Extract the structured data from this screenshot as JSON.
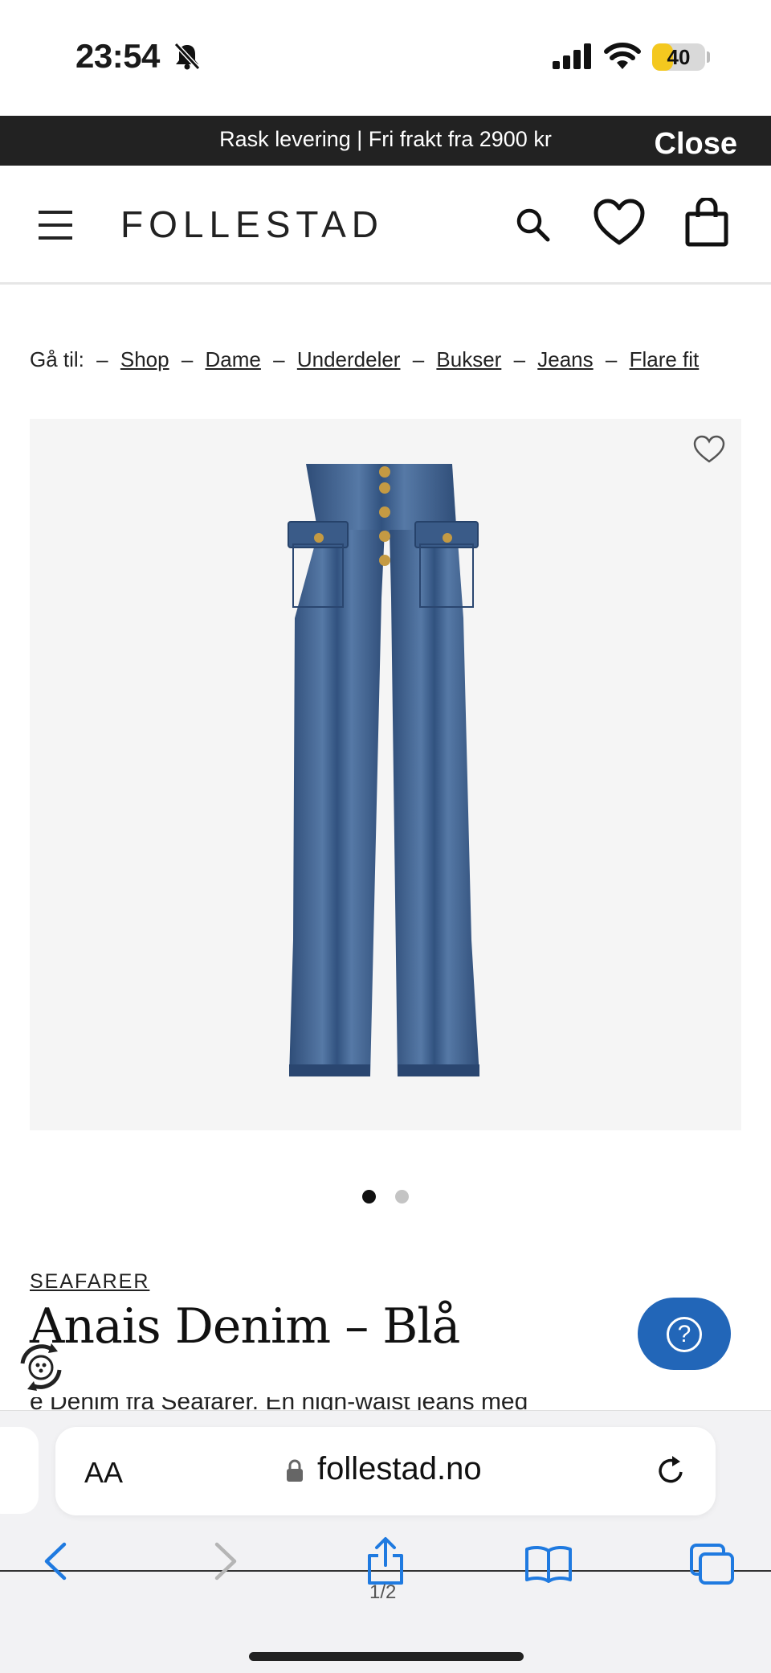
{
  "status_bar": {
    "time": "23:54",
    "battery_level": "40",
    "battery_fraction": 0.4,
    "battery_color": "#f4c81f"
  },
  "promo": {
    "text": "Rask levering | Fri frakt fra 2900 kr",
    "close_label": "Close"
  },
  "header": {
    "logo": "FOLLESTAD",
    "icons": [
      "menu-icon",
      "search-icon",
      "heart-icon",
      "bag-icon"
    ]
  },
  "breadcrumb": {
    "prefix": "Gå til:",
    "separator": "–",
    "items": [
      "Shop",
      "Dame",
      "Underdeler",
      "Bukser",
      "Jeans",
      "Flare fit"
    ]
  },
  "product": {
    "brand": "SEAFARER",
    "title": "Anais Denim – Blå",
    "description_partial": "e Denim fra Seafarer. En high-waist jeans med",
    "image_count": 2,
    "active_image": 1
  },
  "help_button": {
    "icon": "question-icon",
    "color": "#2266b8"
  },
  "safari": {
    "aa_label": "AA",
    "url": "follestad.no",
    "page_indicator": "1/2",
    "accent": "#1f7ae0"
  }
}
